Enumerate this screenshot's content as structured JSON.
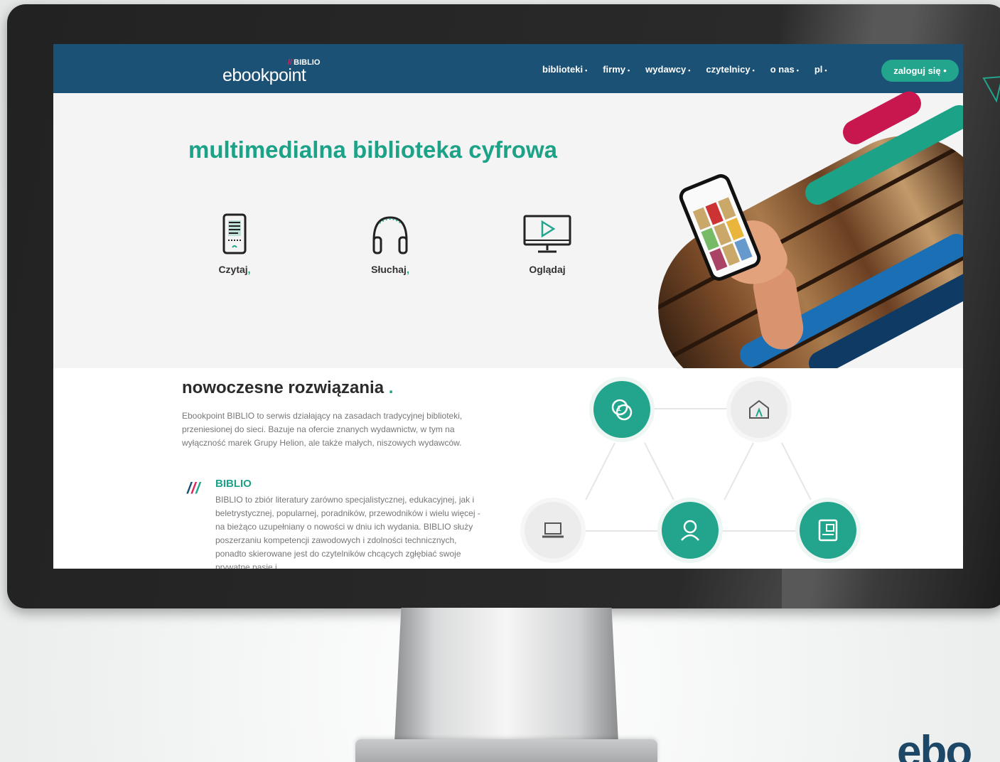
{
  "nav": {
    "logo_biblio": "BIBLIO",
    "logo_light": "ebook",
    "logo_bold": "point",
    "items": [
      {
        "label": "biblioteki",
        "dot": "•"
      },
      {
        "label": "firmy",
        "dot": "•"
      },
      {
        "label": "wydawcy",
        "dot": "•"
      },
      {
        "label": "czytelnicy",
        "dot": "•"
      },
      {
        "label": "o nas",
        "dot": "•"
      },
      {
        "label": "pl",
        "dot": "•"
      }
    ],
    "login": "zaloguj się •"
  },
  "hero": {
    "title": "multimedialna biblioteka cyfrowa",
    "features": [
      {
        "label": "Czytaj",
        "sep": ",",
        "icon": "ebook-reader-icon"
      },
      {
        "label": "Słuchaj",
        "sep": ",",
        "icon": "headphones-icon"
      },
      {
        "label": "Oglądaj",
        "sep": "",
        "icon": "video-monitor-icon"
      }
    ]
  },
  "section": {
    "heading": "nowoczesne rozwiązania",
    "heading_dot": ".",
    "intro": "Ebookpoint BIBLIO to serwis działający na zasadach tradycyjnej biblioteki, przeniesionej do sieci. Bazuje na ofercie znanych wydawnictw, w tym na wyłączność marek Grupy Helion, ale także małych, niszowych wydawców.",
    "biblio_heading": "BIBLIO",
    "biblio_text": "BIBLIO to zbiór literatury zarówno specjalistycznej, edukacyjnej, jak i beletrystycznej, popularnej, poradników, przewodników i wielu więcej - na bieżąco uzupełniany o nowości w dniu ich wydania. BIBLIO służy poszerzaniu kompetencji zawodowych i zdolności technicznych, ponadto skierowane jest do czytelników chcących zgłębiać swoje prywatne pasje i"
  },
  "corner_logo": "ebo",
  "colors": {
    "navy": "#1b5175",
    "teal": "#1ca287",
    "pink": "#e0245e",
    "blue": "#1a6fb5",
    "darkblue": "#0f3a63"
  }
}
